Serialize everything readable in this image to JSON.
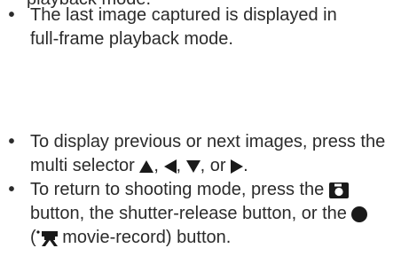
{
  "top_line_fragment": "playback mode.",
  "bullets": [
    {
      "symbol": "•",
      "line1": "The last image captured is displayed in",
      "line2": "full-frame playback mode."
    },
    {
      "symbol": "•",
      "line1": "To display previous or next images, press the",
      "line2_prefix": "multi selector",
      "sep1": ",",
      "sep2": ",",
      "sep3": ", or",
      "line2_suffix": "."
    },
    {
      "symbol": "•",
      "line1_prefix": "To return to shooting mode, press the",
      "line2": "button, the shutter-release button, or the",
      "line3_open": "(",
      "line3_text": " movie-record) button."
    }
  ],
  "icons": {
    "arrows": [
      "up-triangle-icon",
      "left-triangle-icon",
      "down-triangle-icon",
      "right-triangle-icon"
    ],
    "camera": "camera-icon",
    "record": "record-dot-icon",
    "movie": "movie-camera-icon"
  },
  "colors": {
    "text": "#2b2b2b"
  }
}
